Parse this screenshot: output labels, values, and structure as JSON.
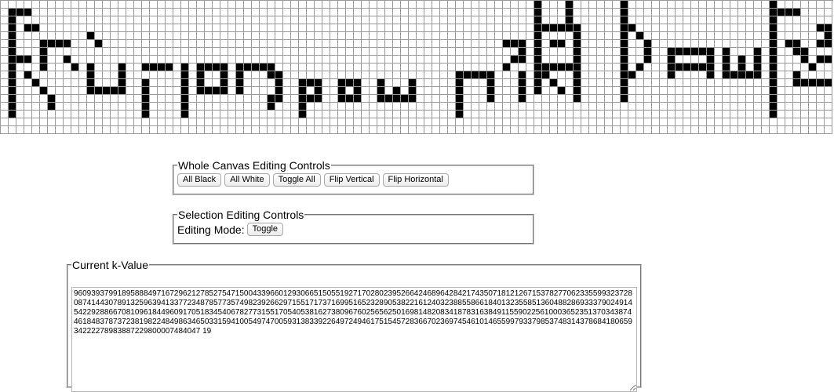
{
  "canvas": {
    "rows": [
      "1111111111111111111111111111111111111111111111111111111111111111111111111111111111111111111111111111111111",
      "0000000000000000000000000000000000000000000000000000000000000000000000000000000000000000000000000000000000"
    ],
    "pattern": [
      "0000000000000000000000000000000000000000000000000000000000000000000010001000000100000000000000000010000000",
      "0111000000000000000000000000000000000000000000000000000000000000000010001000000100000000000000000011110000",
      "0100000000000000000000000000000000000000000000000000000000000000000010001000000100000000000000000010000000",
      "0101100000000000000000000000000000000000000000000000000000000000000011111100000110000000000000000010000011",
      "0100000000010000000000000000000000000000000000000000000000000000000010000100000101000000000000000010000001",
      "0100011110001000000000000000000000000000000000000000000000000000111010110100000100100000000000000010110011",
      "0100010000000000000000000000000000000000000000000000000000000000001010000100000100100111111010001010011000",
      "0111010010000000000000000000000000000000000000000000000000000000011010000100000100100100001010101010001011",
      "0100010001010001001111010111101111100000000000000000000000000000100011111100000101000111111010101010000100",
      "0101000000010001000000010100101000110000000000000000000000111110001011000100000110000100001011111010010000",
      "0100100000010001001000010100101000010011100111001000100000100010001010100100000100000000000000000010011111",
      "0100010000011111001000010111101000010010100101001010100000100010001010010100000100000000000000000010000000",
      "0100001000000000001000010000000000110011100111001111100000100010001000000100000100000000000000000010000000",
      "0100001000000000001000010000000000100010000000000000000000100000000000000000000000000000000000000010000000",
      "0100000000000000001000010000000000000010000000000000000000100000000000000000000000000000000000000010000000",
      "0000000000000000000000000000000000000000000000000000000000000000000000000000000000000000000000000000000000"
    ]
  },
  "whole_canvas": {
    "legend": "Whole Canvas Editing Controls",
    "buttons": [
      "All Black",
      "All White",
      "Toggle All",
      "Flip Vertical",
      "Flip Horizontal"
    ]
  },
  "selection": {
    "legend": "Selection Editing Controls",
    "mode_label": "Editing Mode:",
    "toggle_label": "Toggle"
  },
  "k_value": {
    "legend": "Current k-Value",
    "value": "9609393799189588849716729621278527547150043396601293066515055192717028023952664246896428421743507181212671537827706233559932372808741443078913259639413377234878577357498239266297155171737169951652328905382216124032388558661840132355851360488286933379024914542292886670810961844960917051834540678277315517054053816273809676025656250169814820834187831638491155902256100036523513703438744618483787372381982248498634650331594100549747005931383392264972494617515457283667023697454610146559979337985374831437868418065934222278983887229800007484047 19"
  }
}
